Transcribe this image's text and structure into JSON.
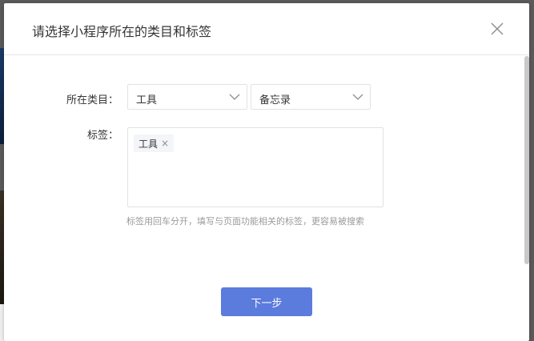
{
  "dialog": {
    "title": "请选择小程序所在的类目和标签",
    "close_icon": "close-icon"
  },
  "form": {
    "category_label": "所在类目：",
    "category_primary": "工具",
    "category_secondary": "备忘录",
    "tags_label": "标签：",
    "tags": [
      "工具"
    ],
    "tag_remove_glyph": "×",
    "hint": "标签用回车分开，填写与页面功能相关的标签，更容易被搜索"
  },
  "footer": {
    "next_label": "下一步"
  },
  "colors": {
    "primary_button": "#5b7bdd",
    "border": "#e2e2e2",
    "hint_text": "#9a9a9a"
  }
}
